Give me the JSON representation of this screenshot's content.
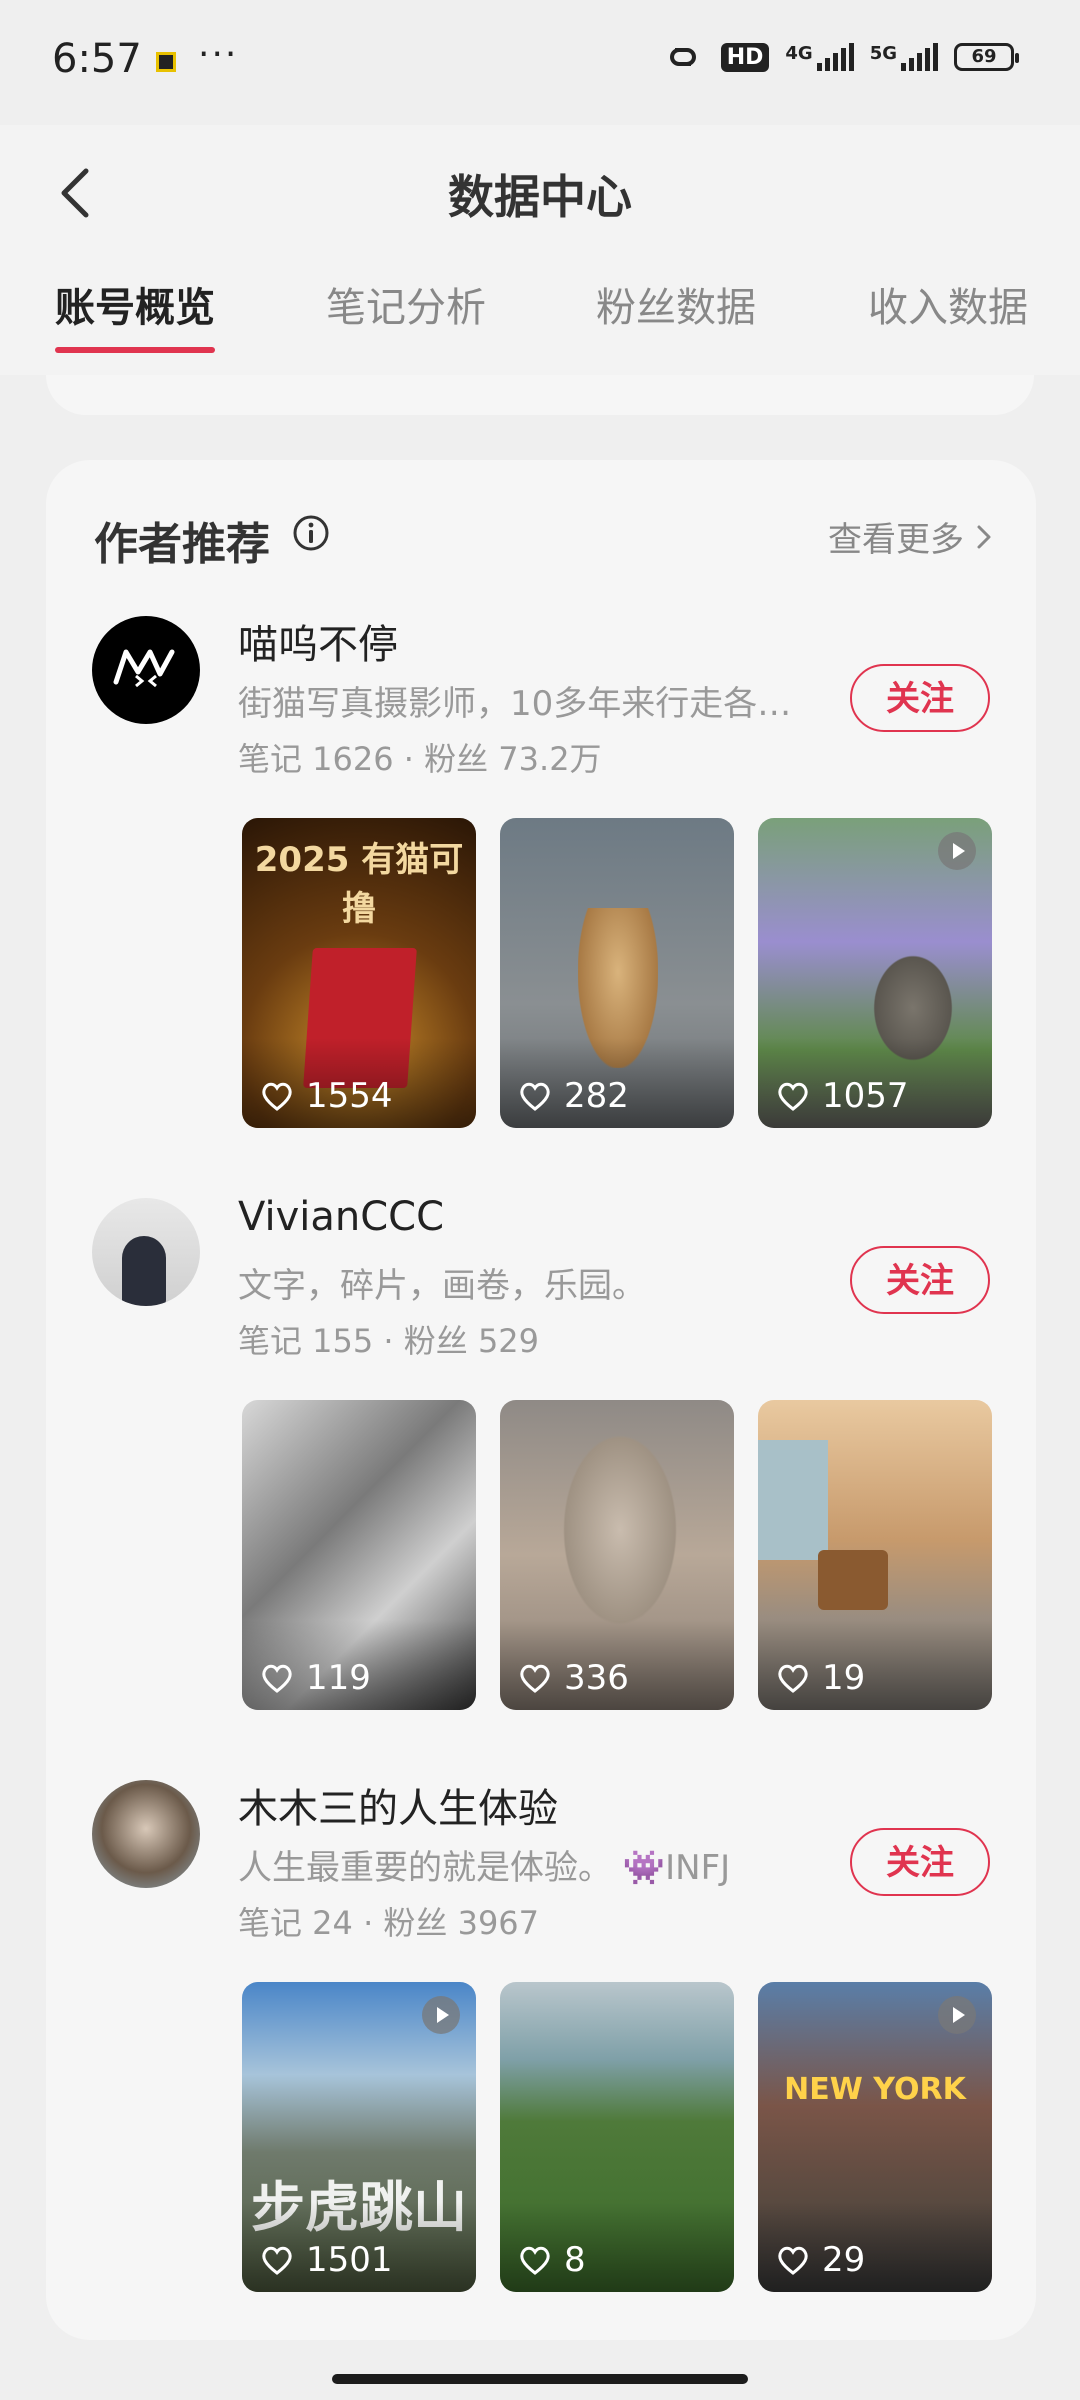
{
  "status_bar": {
    "time": "6:57",
    "dots": "···",
    "hd": "HD",
    "net1": "4G",
    "net2": "5G",
    "battery": "69"
  },
  "header": {
    "title": "数据中心",
    "tabs": [
      {
        "label": "账号概览",
        "active": true
      },
      {
        "label": "笔记分析",
        "active": false
      },
      {
        "label": "粉丝数据",
        "active": false
      },
      {
        "label": "收入数据",
        "active": false
      }
    ]
  },
  "section": {
    "title": "作者推荐",
    "more_label": "查看更多"
  },
  "follow_label": "关注",
  "authors": [
    {
      "name": "喵呜不停",
      "desc": "街猫写真摄影师，10多年来行走各地...",
      "stats": "笔记 1626 · 粉丝 73.2万",
      "posts": [
        {
          "likes": "1554",
          "video": false,
          "overlay": "2025 有猫可撸"
        },
        {
          "likes": "282",
          "video": false
        },
        {
          "likes": "1057",
          "video": true
        }
      ]
    },
    {
      "name": "VivianCCC",
      "desc": "文字，碎片，画卷，乐园。",
      "stats": "笔记 155 · 粉丝 529",
      "posts": [
        {
          "likes": "119",
          "video": false
        },
        {
          "likes": "336",
          "video": false
        },
        {
          "likes": "19",
          "video": false
        }
      ]
    },
    {
      "name": "木木三的人生体验",
      "desc": "人生最重要的就是体验。 👾INFJ",
      "stats": "笔记 24 · 粉丝 3967",
      "posts": [
        {
          "likes": "1501",
          "video": true,
          "overlay": "步虎跳山"
        },
        {
          "likes": "8",
          "video": false
        },
        {
          "likes": "29",
          "video": true,
          "overlay": "NEW YORK"
        }
      ]
    }
  ],
  "colors": {
    "accent": "#e0344f",
    "page_bg": "#efefef",
    "card_bg": "#f6f6f6"
  }
}
